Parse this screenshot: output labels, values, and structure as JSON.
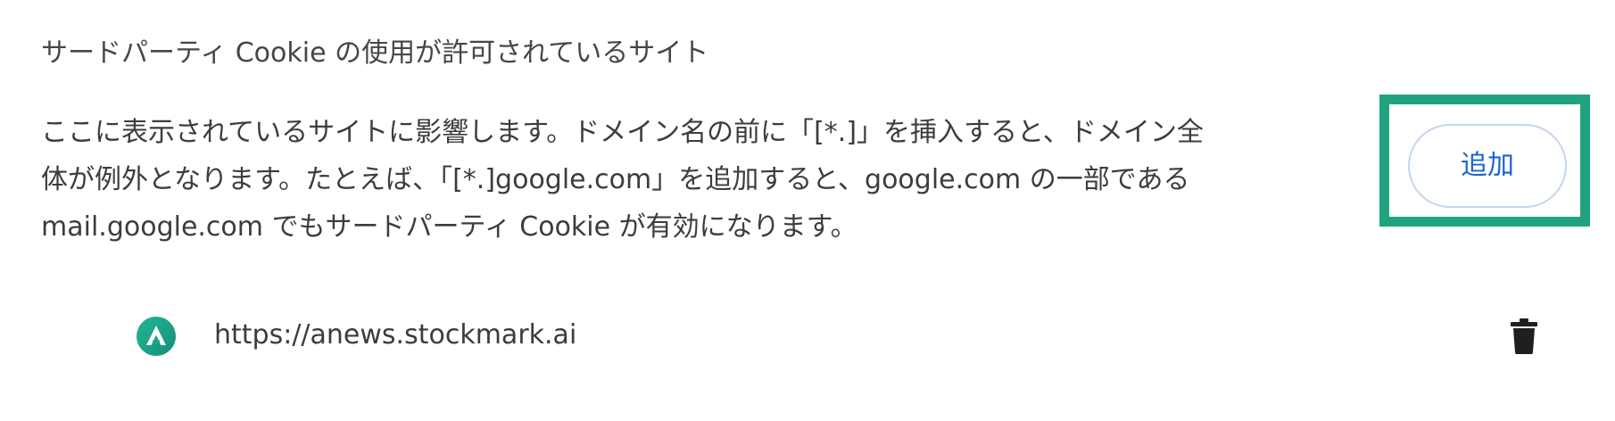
{
  "section": {
    "title": "サードパーティ Cookie の使用が許可されているサイト",
    "description_lines": [
      "ここに表示されているサイトに影響します。ドメイン名の前に「[*.]」を挿入すると、ドメイン全",
      "体が例外となります。たとえば、「[*.]google.com」を追加すると、google.com の一部である",
      "mail.google.com でもサードパーティ Cookie が有効になります。"
    ],
    "add_button_label": "追加"
  },
  "sites": [
    {
      "url": "https://anews.stockmark.ai",
      "favicon_icon": "stockmark-a-logo-icon",
      "delete_icon": "trash-icon"
    }
  ],
  "colors": {
    "highlight_border": "#1fa37f",
    "button_text": "#1a61d4",
    "button_border": "#c4d4f1",
    "favicon_bg": "#1aa58a"
  }
}
